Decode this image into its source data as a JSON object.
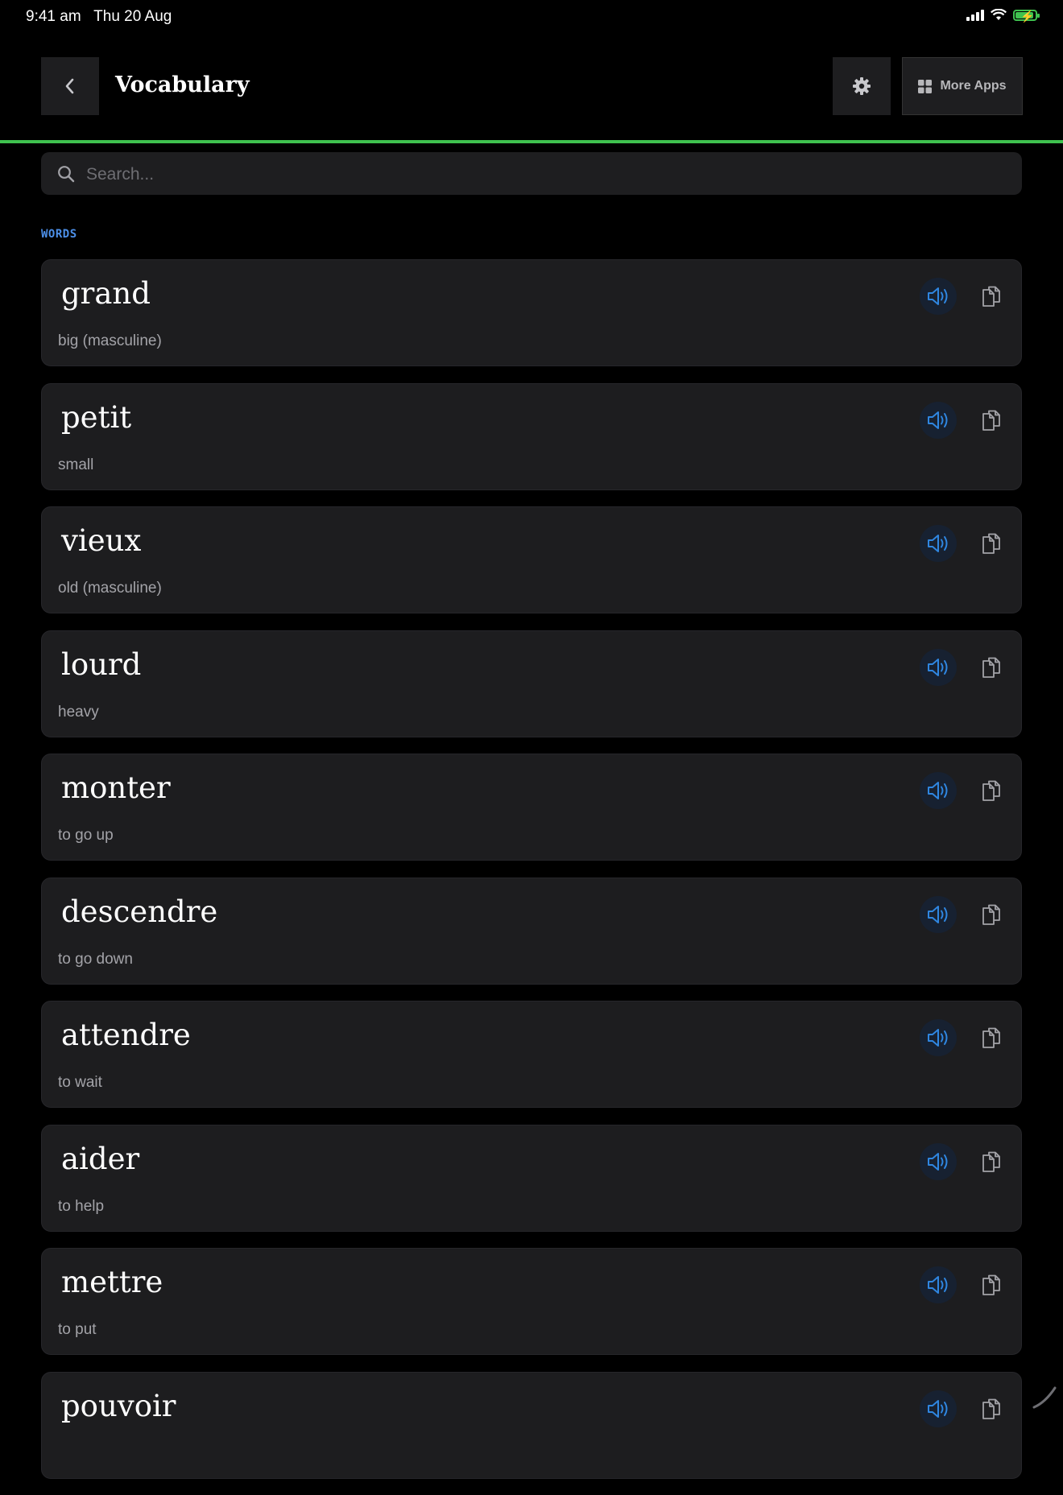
{
  "status_bar": {
    "time": "9:41 am",
    "date": "Thu 20 Aug"
  },
  "header": {
    "title": "Vocabulary",
    "more_apps_label": "More Apps"
  },
  "icons": {
    "back": "chevron-left-icon",
    "settings": "gear-icon",
    "apps": "grid-icon",
    "search": "search-icon",
    "speak": "speaker-icon",
    "copy": "copy-icon"
  },
  "colors": {
    "accent_line": "#3fc24f",
    "section_label": "#4c8fe8",
    "speaker_icon": "#2f86e0",
    "card_background": "#1d1d1f"
  },
  "search": {
    "placeholder": "Search...",
    "value": ""
  },
  "section": {
    "label": "WORDS"
  },
  "words": [
    {
      "term": "grand",
      "translation": "big (masculine)"
    },
    {
      "term": "petit",
      "translation": "small"
    },
    {
      "term": "vieux",
      "translation": "old (masculine)"
    },
    {
      "term": "lourd",
      "translation": "heavy"
    },
    {
      "term": "monter",
      "translation": "to go up"
    },
    {
      "term": "descendre",
      "translation": "to go down"
    },
    {
      "term": "attendre",
      "translation": "to wait"
    },
    {
      "term": "aider",
      "translation": "to help"
    },
    {
      "term": "mettre",
      "translation": "to put"
    },
    {
      "term": "pouvoir",
      "translation": ""
    }
  ]
}
